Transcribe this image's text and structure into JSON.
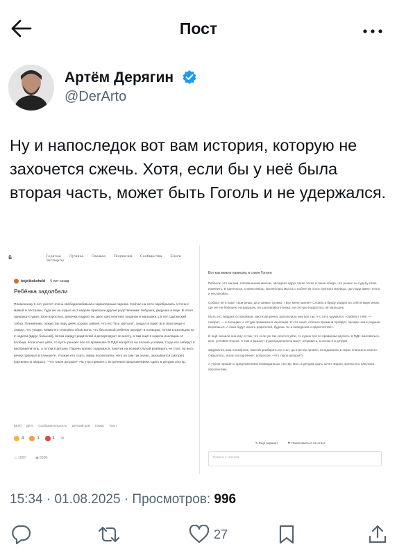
{
  "header": {
    "title": "Пост"
  },
  "author": {
    "name": "Артём Дерягин",
    "handle": "@DerArto"
  },
  "post": {
    "text": "Ну и напоследок вот вам история, которую не захочется сжечь. Хотя, если бы у неё была вторая часть, может быть Гоголь и не удержался."
  },
  "screenshot_left": {
    "logo": "ü",
    "nav": [
      "Горячее",
      "Лучшее",
      "Свежее",
      "Подписки",
      "Сообщества",
      "Блоги",
      "Эксперты"
    ],
    "author": "bojelikokoheld",
    "time": "5 лет назад",
    "title": "Ребёнка задолбали",
    "body": "Племяннику 6 лет, растёт очень свободолюбивым и характерным парнем. Сейчас на лето перебрались в Сочи с мамой и сёстрами, туда же на отдых на 3 недели приехали другие родственники: бабушка, дедушка и внук. В итоге однушка-студия, трое взрослых, девочка подросток, двое шестилетних пацанов и малышка 1.5 лет. Цыганский табор. Племянник, пожив так пару дней, громко заявил, что его \"все заe*али\", скидал в пакет все свои вещи и сказал, что уходит. Мама его спокойно объяснила, что бесхозный ребёнок попадёт в полицию, потом в изоляцию на 2 недели (вдруг больной), потом найдут родителей и депортируют по месту, а там ещё 2 недели изоляции. И вообще, если хочет уйти, то пусть решает все по правилам. В ПДН жалуется на плохие условия, тогда его заберут в распределитель, а потом в детдом. Парень крепко задумался, пакетик на всякий случай разбирать не стал, на весь вечер приуныл в планшете. Уложив его спать, мама посмотрела, чего он там так залип, оказывается смотрел картинки по запросу: \"Что такое детдом?\" На утро пришёл с встречным предложением: сдать в детдом сестер.",
    "tags": [
      "[моё]",
      "Дети",
      "Сообразительность",
      "Детский дом",
      "Юмор",
      "Текст"
    ],
    "reactions": [
      "4",
      "1",
      "1"
    ],
    "stats": [
      "1597",
      "650K"
    ]
  },
  "screenshot_right": {
    "intro": "Вот как можно написать в стиле Гоголя:",
    "paragraphs": [
      "Ребёнок, что малым, племянником милым, овладела вдруг такая тоска и такая обида, что решил он судьбу свою изменить. В одночасье, словно вихрь, пронёслась мысль о побеге из этого суетного жилища, где люди живут тесно и неспокойно.",
      "Собрал он в пакет свои вещи, да и заявил громко: «Все меня заели!» Словно в бреду увидел он себя в мире ином, где нет ни бабушек, ни дедушек, ни шаловливого внука, ни сестры-подростка, ни малышек.",
      "Мать его, мудрая и спокойная, как тихая речка, разъяснила ему всё так, что он и одумался. «Заберут тебя, — говорит, — в полицию, а оттуда прямиком в изоляцию. И кто знает, сколько времени пройдёт, прежде чем к родным вернёшься. А пока будут искать родителей, будешь ты в неведении и одиночестве».",
      "И ещё сказала она ему о том, что если уж так хочется уйти, то нужно всё по правилам сделать: в ПДН жаловаться, мол, условия плохие. А там и возьмут в распределитель могут отправить, а потом и в детдом.",
      "Задумался наш племянник, пакетик разбирать не стал, да и вечер провёл, вглядываясь в экран планшета своего. Оказалось, искал он картинки с вопросом: «Что такое детдом?»",
      "А утром пришёл с предложением неожиданным: сестёр, мол, в детдом сдать хочет. Видно, крепко его напугала перспектива."
    ],
    "actions": [
      "Ещё вариант",
      "Пожаловаться на ответ"
    ],
    "comment_placeholder": "Помочь с текстом"
  },
  "meta": {
    "time": "15:34",
    "date": "01.08.2025",
    "views_label": "Просмотров:",
    "views": "996"
  },
  "actions": {
    "likes": "27"
  },
  "colors": {
    "text": "#0f1419",
    "secondary": "#536471",
    "verified": "#1d9bf0"
  }
}
